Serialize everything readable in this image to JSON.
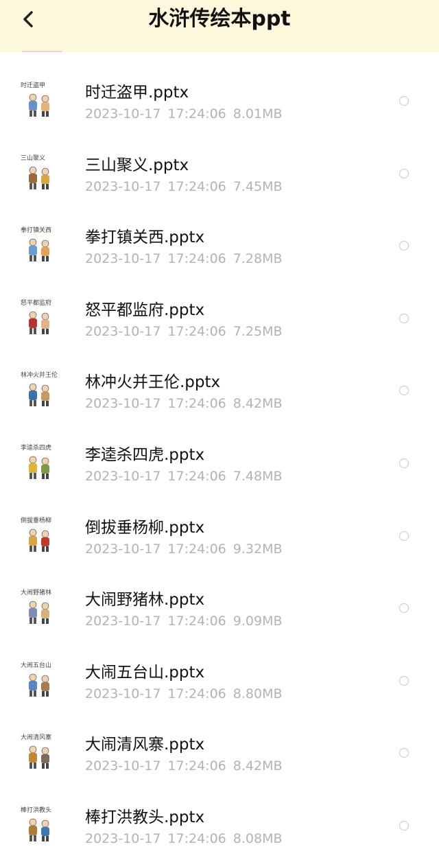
{
  "header": {
    "title": "水浒传绘本ppt",
    "back_icon": "chevron-left-icon",
    "background": "#fdf8dc"
  },
  "files": [
    {
      "caption": "时迁盗甲",
      "name": "时迁盗甲.pptx",
      "date": "2023-10-17",
      "time": "17:24:06",
      "size": "8.01MB"
    },
    {
      "caption": "三山聚义",
      "name": "三山聚义.pptx",
      "date": "2023-10-17",
      "time": "17:24:06",
      "size": "7.45MB"
    },
    {
      "caption": "拳打镇关西",
      "name": "拳打镇关西.pptx",
      "date": "2023-10-17",
      "time": "17:24:06",
      "size": "7.28MB"
    },
    {
      "caption": "怒平都监府",
      "name": "怒平都监府.pptx",
      "date": "2023-10-17",
      "time": "17:24:06",
      "size": "7.25MB"
    },
    {
      "caption": "林冲火并王伦",
      "name": "林冲火并王伦.pptx",
      "date": "2023-10-17",
      "time": "17:24:06",
      "size": "8.42MB"
    },
    {
      "caption": "李逵杀四虎",
      "name": "李逵杀四虎.pptx",
      "date": "2023-10-17",
      "time": "17:24:06",
      "size": "7.48MB"
    },
    {
      "caption": "倒拔垂杨柳",
      "name": "倒拔垂杨柳.pptx",
      "date": "2023-10-17",
      "time": "17:24:06",
      "size": "9.32MB"
    },
    {
      "caption": "大闹野猪林",
      "name": "大闹野猪林.pptx",
      "date": "2023-10-17",
      "time": "17:24:06",
      "size": "9.09MB"
    },
    {
      "caption": "大闹五台山",
      "name": "大闹五台山.pptx",
      "date": "2023-10-17",
      "time": "17:24:06",
      "size": "8.80MB"
    },
    {
      "caption": "大闹清风寨",
      "name": "大闹清风寨.pptx",
      "date": "2023-10-17",
      "time": "17:24:06",
      "size": "8.42MB"
    },
    {
      "caption": "棒打洪教头",
      "name": "棒打洪教头.pptx",
      "date": "2023-10-17",
      "time": "17:24:06",
      "size": "8.08MB"
    }
  ]
}
